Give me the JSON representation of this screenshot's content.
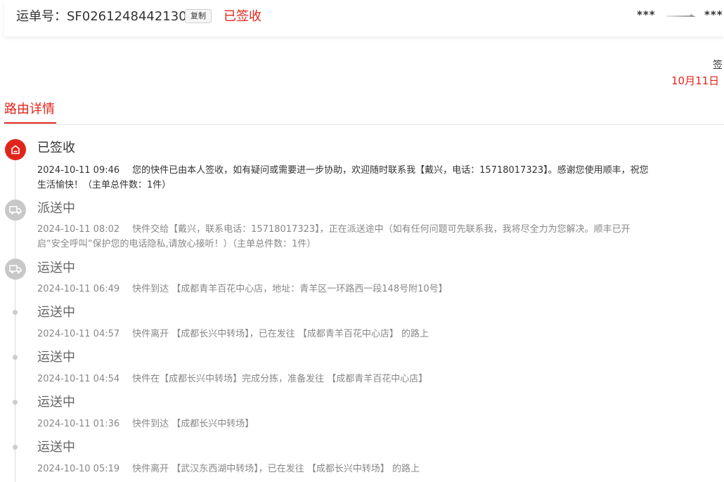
{
  "header": {
    "waybill_label": "运单号：",
    "waybill_number": "SF0261248442130",
    "copy_label": "复制",
    "status": "已签收",
    "route_from": "***",
    "route_to": "***"
  },
  "sign_info": {
    "label": "签",
    "date": "10月11日"
  },
  "tabs": {
    "route_detail": "路由详情"
  },
  "colors": {
    "accent": "#e1251b",
    "inactive_icon": "#c8c8c8"
  },
  "timeline": [
    {
      "title": "已签收",
      "time": "2024-10-11 09:46",
      "desc": "您的快件已由本人签收，如有疑问或需要进一步协助，欢迎随时联系我【戴兴，电话：15718017323】。感谢您使用顺丰，祝您生活愉快！（主单总件数：1件）",
      "icon": "signed-home-icon",
      "state": "active"
    },
    {
      "title": "派送中",
      "time": "2024-10-11 08:02",
      "desc": "快件交给【戴兴，联系电话：15718017323】，正在派送途中（如有任何问题可先联系我，我将尽全力为您解决。顺丰已开启“安全呼叫”保护您的电话隐私,请放心接听！）（主单总件数：1件）",
      "icon": "delivery-truck-icon",
      "state": "inactive"
    },
    {
      "title": "运送中",
      "time": "2024-10-11 06:49",
      "desc": "快件到达 【成都青羊百花中心店，地址：青羊区一环路西一段148号附10号】",
      "icon": "transit-truck-icon",
      "state": "inactive"
    },
    {
      "title": "运送中",
      "time": "2024-10-11 04:57",
      "desc": "快件离开 【成都长兴中转场】，已在发往 【成都青羊百花中心店】 的路上",
      "icon": "dot",
      "state": "inactive"
    },
    {
      "title": "运送中",
      "time": "2024-10-11 04:54",
      "desc": "快件在【成都长兴中转场】完成分拣，准备发往 【成都青羊百花中心店】",
      "icon": "dot",
      "state": "inactive"
    },
    {
      "title": "运送中",
      "time": "2024-10-11 01:36",
      "desc": "快件到达 【成都长兴中转场】",
      "icon": "dot",
      "state": "inactive"
    },
    {
      "title": "运送中",
      "time": "2024-10-10 05:19",
      "desc": "快件离开 【武汉东西湖中转场】，已在发往 【成都长兴中转场】 的路上",
      "icon": "dot",
      "state": "inactive"
    }
  ]
}
